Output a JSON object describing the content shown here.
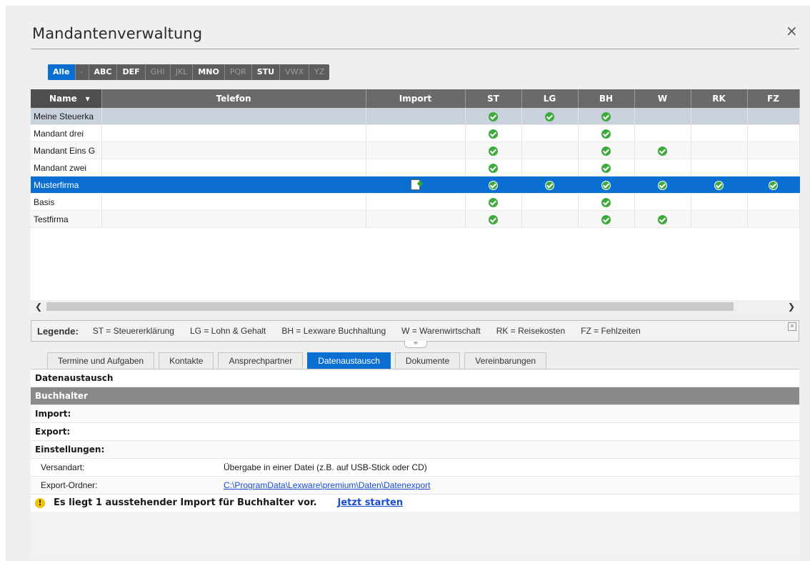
{
  "window": {
    "title": "Mandantenverwaltung",
    "close_glyph": "×"
  },
  "alpha_filter": [
    "Alle",
    "-",
    "ABC",
    "DEF",
    "GHI",
    "JKL",
    "MNO",
    "PQR",
    "STU",
    "VWX",
    "YZ"
  ],
  "alpha_state": [
    "active",
    "disabled",
    "",
    "",
    "disabled",
    "disabled",
    "",
    "disabled",
    "",
    "disabled",
    "disabled"
  ],
  "grid": {
    "columns": [
      "Name",
      "Telefon",
      "Import",
      "ST",
      "LG",
      "BH",
      "W",
      "RK",
      "FZ"
    ],
    "rows": [
      {
        "name": "Meine Steuerka",
        "import": false,
        "ST": true,
        "LG": true,
        "BH": true,
        "W": false,
        "RK": false,
        "FZ": false
      },
      {
        "name": "Mandant drei",
        "import": false,
        "ST": true,
        "LG": false,
        "BH": true,
        "W": false,
        "RK": false,
        "FZ": false
      },
      {
        "name": "Mandant Eins G",
        "import": false,
        "ST": true,
        "LG": false,
        "BH": true,
        "W": true,
        "RK": false,
        "FZ": false
      },
      {
        "name": "Mandant zwei",
        "import": false,
        "ST": true,
        "LG": false,
        "BH": true,
        "W": false,
        "RK": false,
        "FZ": false
      },
      {
        "name": "Musterfirma",
        "import": true,
        "ST": true,
        "LG": true,
        "BH": true,
        "W": true,
        "RK": true,
        "FZ": true
      },
      {
        "name": "Basis",
        "import": false,
        "ST": true,
        "LG": false,
        "BH": true,
        "W": false,
        "RK": false,
        "FZ": false
      },
      {
        "name": "Testfirma",
        "import": false,
        "ST": true,
        "LG": false,
        "BH": true,
        "W": true,
        "RK": false,
        "FZ": false
      }
    ],
    "selected_index": 4
  },
  "legend": {
    "label": "Legende:",
    "items": [
      "ST = Steuererklärung",
      "LG = Lohn & Gehalt",
      "BH = Lexware Buchhaltung",
      "W = Warenwirtschaft",
      "RK = Reisekosten",
      "FZ = Fehlzeiten"
    ]
  },
  "tabs": [
    "Termine und Aufgaben",
    "Kontakte",
    "Ansprechpartner",
    "Datenaustausch",
    "Dokumente",
    "Vereinbarungen"
  ],
  "active_tab": 3,
  "detail": {
    "section_title": "Datenaustausch",
    "group_header": "Buchhalter",
    "import_label": "Import:",
    "export_label": "Export:",
    "settings_label": "Einstellungen:",
    "versandart_label": "Versandart:",
    "versandart_value": "Übergabe in einer Datei (z.B. auf USB-Stick oder CD)",
    "exportordner_label": "Export-Ordner:",
    "exportordner_value": "C:\\ProgramData\\Lexware\\premium\\Daten\\Datenexport",
    "notice_text": "Es liegt 1 ausstehender Import für Buchhalter vor.",
    "notice_link": "Jetzt starten"
  },
  "colors": {
    "accent": "#0a6fd0",
    "check": "#3eaa3e",
    "header": "#6a6a6a"
  }
}
